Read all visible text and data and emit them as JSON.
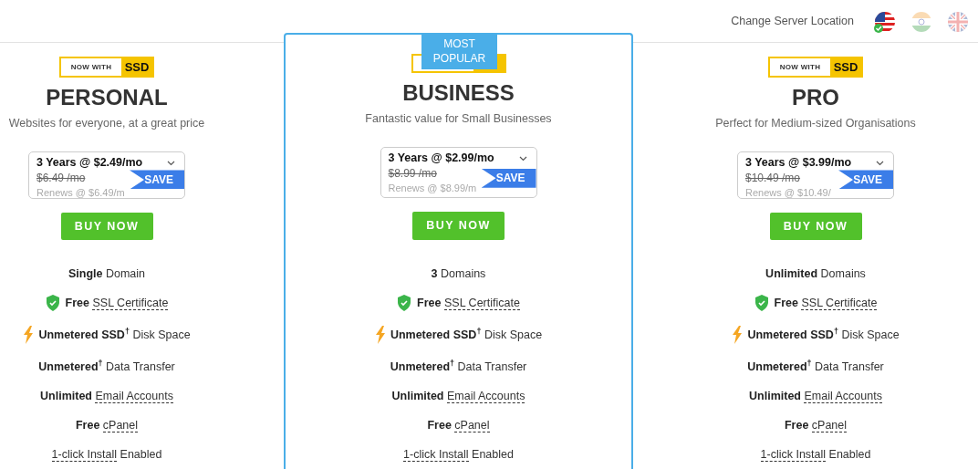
{
  "header": {
    "label": "Change Server Location",
    "locations": [
      {
        "kind": "us",
        "selected": true
      },
      {
        "kind": "in",
        "selected": false
      },
      {
        "kind": "uk",
        "selected": false
      }
    ]
  },
  "plans": [
    {
      "badge": {
        "label": "NOW WITH",
        "tag": "SSD"
      },
      "name": "PERSONAL",
      "featured": false,
      "description": "Websites for everyone, at a great price",
      "term": "3 Years @ $2.49/mo",
      "old_price": "$6.49 /mo",
      "renews": "Renews @ $6.49/m",
      "save": "SAVE",
      "button": "BUY NOW",
      "features": [
        {
          "parts": [
            {
              "kind": "strong",
              "text": "Single"
            },
            {
              "kind": "plain",
              "text": "Domain"
            }
          ]
        },
        {
          "kind": "shield",
          "parts": [
            {
              "kind": "strong",
              "text": "Free"
            },
            {
              "kind": "tooltip",
              "text": "SSL Certificate"
            }
          ]
        },
        {
          "kind": "bolt",
          "parts": [
            {
              "kind": "strong",
              "text": "Unmetered SSD$^{†}$"
            },
            {
              "kind": "plain",
              "text": "Disk Space"
            }
          ]
        },
        {
          "parts": [
            {
              "kind": "strong",
              "text": "Unmetered$^{†}$"
            },
            {
              "kind": "plain",
              "text": "Data Transfer"
            }
          ]
        },
        {
          "parts": [
            {
              "kind": "strong",
              "text": "Unlimited"
            },
            {
              "kind": "tooltip",
              "text": "Email Accounts"
            }
          ]
        },
        {
          "parts": [
            {
              "kind": "strong",
              "text": "Free"
            },
            {
              "kind": "tooltip",
              "text": "cPanel"
            }
          ]
        },
        {
          "parts": [
            {
              "kind": "tooltip",
              "text": "1-click Install"
            },
            {
              "kind": "plain",
              "text": "Enabled"
            }
          ]
        }
      ]
    },
    {
      "ribbon": [
        "MOST",
        "POPULAR"
      ],
      "name": "BUSINESS",
      "featured": true,
      "description": "Fantastic value for Small Businesses",
      "term": "3 Years @ $2.99/mo",
      "old_price": "$8.99 /mo",
      "renews": "Renews @ $8.99/m",
      "save": "SAVE",
      "button": "BUY NOW",
      "features": [
        {
          "parts": [
            {
              "kind": "strong",
              "text": "3"
            },
            {
              "kind": "plain",
              "text": "Domains"
            }
          ]
        },
        {
          "kind": "shield",
          "parts": [
            {
              "kind": "strong",
              "text": "Free"
            },
            {
              "kind": "tooltip",
              "text": "SSL Certificate"
            }
          ]
        },
        {
          "kind": "bolt",
          "parts": [
            {
              "kind": "strong",
              "text": "Unmetered SSD$^{†}$"
            },
            {
              "kind": "plain",
              "text": "Disk Space"
            }
          ]
        },
        {
          "parts": [
            {
              "kind": "strong",
              "text": "Unmetered$^{†}$"
            },
            {
              "kind": "plain",
              "text": "Data Transfer"
            }
          ]
        },
        {
          "parts": [
            {
              "kind": "strong",
              "text": "Unlimited"
            },
            {
              "kind": "tooltip",
              "text": "Email Accounts"
            }
          ]
        },
        {
          "parts": [
            {
              "kind": "strong",
              "text": "Free"
            },
            {
              "kind": "tooltip",
              "text": "cPanel"
            }
          ]
        },
        {
          "parts": [
            {
              "kind": "tooltip",
              "text": "1-click Install"
            },
            {
              "kind": "plain",
              "text": "Enabled"
            }
          ]
        }
      ]
    },
    {
      "badge": {
        "label": "NOW WITH",
        "tag": "SSD"
      },
      "name": "PRO",
      "featured": false,
      "description": "Perfect for Medium-sized Organisations",
      "term": "3 Years @ $3.99/mo",
      "old_price": "$10.49 /mo",
      "renews": "Renews @ $10.49/",
      "save": "SAVE",
      "button": "BUY NOW",
      "features": [
        {
          "parts": [
            {
              "kind": "strong",
              "text": "Unlimited"
            },
            {
              "kind": "plain",
              "text": "Domains"
            }
          ]
        },
        {
          "kind": "shield",
          "parts": [
            {
              "kind": "strong",
              "text": "Free"
            },
            {
              "kind": "tooltip",
              "text": "SSL Certificate"
            }
          ]
        },
        {
          "kind": "bolt",
          "parts": [
            {
              "kind": "strong",
              "text": "Unmetered SSD$^{†}$"
            },
            {
              "kind": "plain",
              "text": "Disk Space"
            }
          ]
        },
        {
          "parts": [
            {
              "kind": "strong",
              "text": "Unmetered$^{†}$"
            },
            {
              "kind": "plain",
              "text": "Data Transfer"
            }
          ]
        },
        {
          "parts": [
            {
              "kind": "strong",
              "text": "Unlimited"
            },
            {
              "kind": "tooltip",
              "text": "Email Accounts"
            }
          ]
        },
        {
          "parts": [
            {
              "kind": "strong",
              "text": "Free"
            },
            {
              "kind": "tooltip",
              "text": "cPanel"
            }
          ]
        },
        {
          "parts": [
            {
              "kind": "tooltip",
              "text": "1-click Install"
            },
            {
              "kind": "plain",
              "text": "Enabled"
            }
          ]
        }
      ]
    }
  ]
}
